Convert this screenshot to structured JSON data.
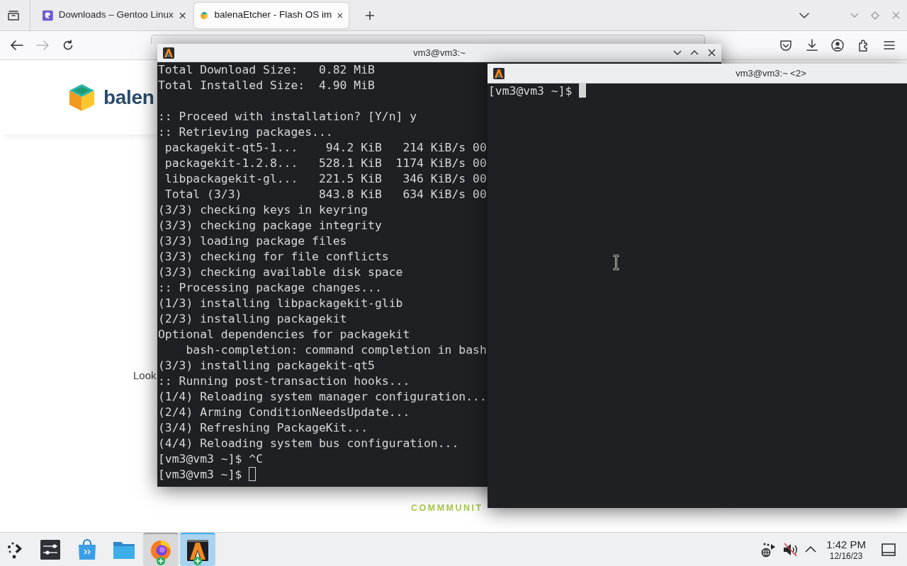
{
  "browser": {
    "tabs": [
      {
        "title": "Downloads – Gentoo Linux",
        "selected": false
      },
      {
        "title": "balenaEtcher - Flash OS im",
        "selected": true
      }
    ],
    "nav": [
      {
        "kind": "back",
        "disabled": false
      },
      {
        "kind": "forward",
        "disabled": true
      },
      {
        "kind": "reload",
        "disabled": false
      }
    ],
    "page": {
      "logo_text": "balen",
      "intro_fragment": "Look",
      "section_label": "COMMMUNIT"
    }
  },
  "terminals": [
    {
      "title": "vm3@vm3:~",
      "focused": false,
      "output_blocks": [
        [
          "Total Download Size:   0.82 MiB",
          "Total Installed Size:  4.90 MiB"
        ],
        [
          ":: Proceed with installation? [Y/n] y",
          ":: Retrieving packages...",
          " packagekit-qt5-1...    94.2 KiB   214 KiB/s 00",
          " packagekit-1.2.8...   528.1 KiB  1174 KiB/s 00",
          " libpackagekit-gl...   221.5 KiB   346 KiB/s 00",
          " Total (3/3)           843.8 KiB   634 KiB/s 00",
          "(3/3) checking keys in keyring",
          "(3/3) checking package integrity",
          "(3/3) loading package files",
          "(3/3) checking for file conflicts",
          "(3/3) checking available disk space",
          ":: Processing package changes...",
          "(1/3) installing libpackagekit-glib",
          "(2/3) installing packagekit",
          "Optional dependencies for packagekit",
          "    bash-completion: command completion in bash",
          "(3/3) installing packagekit-qt5",
          ":: Running post-transaction hooks...",
          "(1/4) Reloading system manager configuration...",
          "(2/4) Arming ConditionNeedsUpdate...",
          "(3/4) Refreshing PackageKit...",
          "(4/4) Reloading system bus configuration...",
          "[vm3@vm3 ~]$ ^C"
        ]
      ],
      "prompt": "[vm3@vm3 ~]$"
    },
    {
      "title": "vm3@vm3:~ <2>",
      "focused": true,
      "prompt": "[vm3@vm3 ~]$"
    }
  ],
  "taskbar": {
    "tasks": [
      {
        "kind": "launcher",
        "running": false,
        "active": false
      },
      {
        "kind": "settings",
        "running": false,
        "active": false
      },
      {
        "kind": "store",
        "running": false,
        "active": false
      },
      {
        "kind": "files",
        "running": false,
        "active": false
      },
      {
        "kind": "browser",
        "running": true,
        "active": false
      },
      {
        "kind": "terminal",
        "running": true,
        "active": true
      }
    ],
    "clock": {
      "time": "1:42 PM",
      "date": "12/16/23"
    }
  }
}
